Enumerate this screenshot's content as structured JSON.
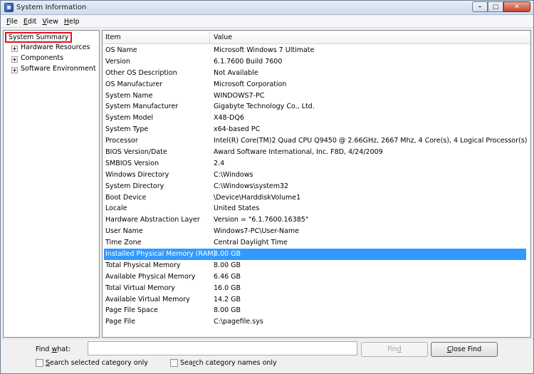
{
  "window": {
    "title": "System Information",
    "controls": {
      "minimize": "–",
      "maximize": "□",
      "close": "✕"
    }
  },
  "menu": [
    {
      "label": "File",
      "accel": "F",
      "rest": "ile"
    },
    {
      "label": "Edit",
      "accel": "E",
      "rest": "dit"
    },
    {
      "label": "View",
      "accel": "V",
      "rest": "iew"
    },
    {
      "label": "Help",
      "accel": "H",
      "rest": "elp"
    }
  ],
  "tree": {
    "root": "System Summary",
    "children": [
      "Hardware Resources",
      "Components",
      "Software Environment"
    ],
    "highlight_color": "#e0111a"
  },
  "list": {
    "columns": [
      "Item",
      "Value"
    ],
    "selected_color": "#3399ff",
    "rows": [
      {
        "item": "OS Name",
        "value": "Microsoft Windows 7 Ultimate"
      },
      {
        "item": "Version",
        "value": "6.1.7600 Build 7600"
      },
      {
        "item": "Other OS Description",
        "value": "Not Available"
      },
      {
        "item": "OS Manufacturer",
        "value": "Microsoft Corporation"
      },
      {
        "item": "System Name",
        "value": "WINDOWS7-PC"
      },
      {
        "item": "System Manufacturer",
        "value": "Gigabyte Technology Co., Ltd."
      },
      {
        "item": "System Model",
        "value": "X48-DQ6"
      },
      {
        "item": "System Type",
        "value": "x64-based PC"
      },
      {
        "item": "Processor",
        "value": "Intel(R) Core(TM)2 Quad  CPU   Q9450  @ 2.66GHz, 2667 Mhz, 4 Core(s), 4 Logical Processor(s)"
      },
      {
        "item": "BIOS Version/Date",
        "value": "Award Software International, Inc. F8D, 4/24/2009"
      },
      {
        "item": "SMBIOS Version",
        "value": "2.4"
      },
      {
        "item": "Windows Directory",
        "value": "C:\\Windows"
      },
      {
        "item": "System Directory",
        "value": "C:\\Windows\\system32"
      },
      {
        "item": "Boot Device",
        "value": "\\Device\\HarddiskVolume1"
      },
      {
        "item": "Locale",
        "value": "United States"
      },
      {
        "item": "Hardware Abstraction Layer",
        "value": "Version = \"6.1.7600.16385\""
      },
      {
        "item": "User Name",
        "value": "Windows7-PC\\User-Name"
      },
      {
        "item": "Time Zone",
        "value": "Central Daylight Time"
      },
      {
        "item": "Installed Physical Memory (RAM)",
        "value": "8.00 GB",
        "selected": true
      },
      {
        "item": "Total Physical Memory",
        "value": "8.00 GB"
      },
      {
        "item": "Available Physical Memory",
        "value": "6.46 GB"
      },
      {
        "item": "Total Virtual Memory",
        "value": "16.0 GB"
      },
      {
        "item": "Available Virtual Memory",
        "value": "14.2 GB"
      },
      {
        "item": "Page File Space",
        "value": "8.00 GB"
      },
      {
        "item": "Page File",
        "value": "C:\\pagefile.sys"
      }
    ]
  },
  "find": {
    "label_pre": "Find ",
    "label_accel": "w",
    "label_post": "hat:",
    "value": "",
    "find_button_pre": "Fin",
    "find_button_accel": "d",
    "close_button_accel": "C",
    "close_button_post": "lose Find",
    "check1_accel": "S",
    "check1_post": "earch selected category only",
    "check2_pre": "Sea",
    "check2_accel": "r",
    "check2_post": "ch category names only"
  }
}
